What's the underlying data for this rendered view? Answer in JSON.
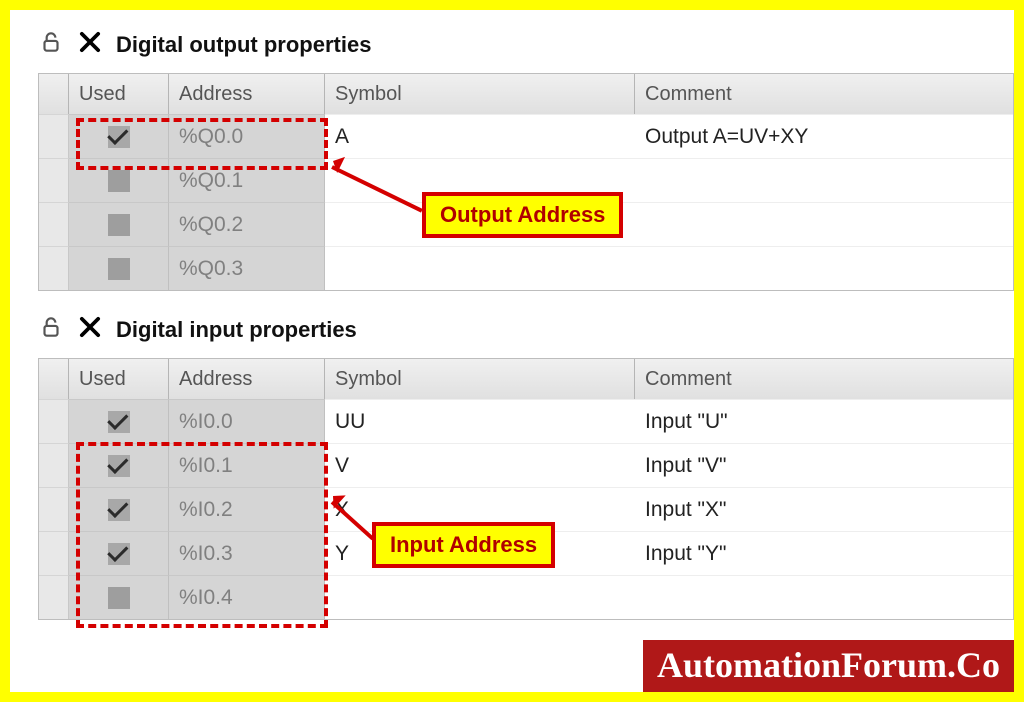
{
  "output_panel": {
    "title": "Digital output properties",
    "columns": {
      "used": "Used",
      "address": "Address",
      "symbol": "Symbol",
      "comment": "Comment"
    },
    "rows": [
      {
        "used": true,
        "address": "%Q0.0",
        "symbol": "A",
        "comment": "Output A=UV+XY"
      },
      {
        "used": false,
        "address": "%Q0.1",
        "symbol": "",
        "comment": ""
      },
      {
        "used": false,
        "address": "%Q0.2",
        "symbol": "",
        "comment": ""
      },
      {
        "used": false,
        "address": "%Q0.3",
        "symbol": "",
        "comment": ""
      }
    ]
  },
  "input_panel": {
    "title": "Digital input properties",
    "columns": {
      "used": "Used",
      "address": "Address",
      "symbol": "Symbol",
      "comment": "Comment"
    },
    "rows": [
      {
        "used": true,
        "address": "%I0.0",
        "symbol": "UU",
        "comment": "Input \"U\""
      },
      {
        "used": true,
        "address": "%I0.1",
        "symbol": "V",
        "comment": "Input \"V\""
      },
      {
        "used": true,
        "address": "%I0.2",
        "symbol": "X",
        "comment": "Input \"X\""
      },
      {
        "used": true,
        "address": "%I0.3",
        "symbol": "Y",
        "comment": "Input \"Y\""
      },
      {
        "used": false,
        "address": "%I0.4",
        "symbol": "",
        "comment": ""
      }
    ]
  },
  "annotations": {
    "output_label": "Output Address",
    "input_label": "Input Address"
  },
  "watermark": "AutomationForum.Co"
}
